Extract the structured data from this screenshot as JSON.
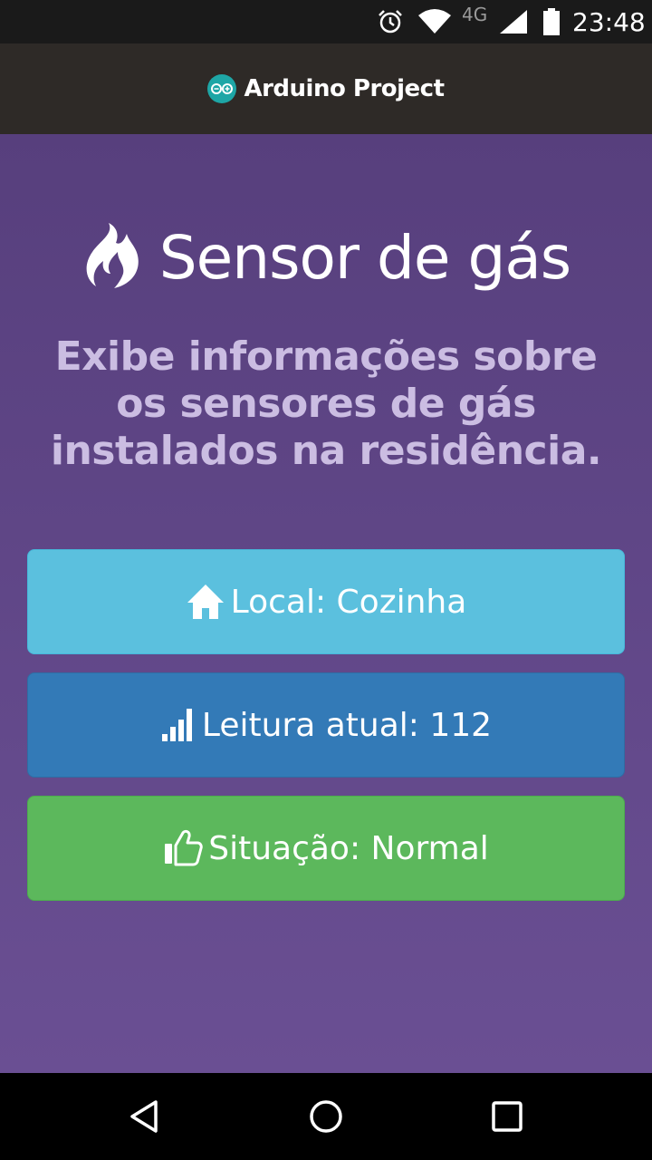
{
  "status_bar": {
    "network": "4G",
    "time": "23:48",
    "icons": [
      "alarm-icon",
      "wifi-icon",
      "signal-icon",
      "battery-icon"
    ]
  },
  "app_bar": {
    "title": "Arduino Project",
    "logo_icon": "arduino-logo-icon"
  },
  "page": {
    "title": "Sensor de gás",
    "title_icon": "fire-icon",
    "subtitle": "Exibe informações sobre os sensores de gás instalados na residência."
  },
  "cards": {
    "local": {
      "label": "Local: Cozinha",
      "icon": "home-icon",
      "color": "#5bc0de"
    },
    "leitura": {
      "label": "Leitura atual: 112",
      "icon": "signal-bars-icon",
      "color": "#337ab7"
    },
    "situacao": {
      "label": "Situação: Normal",
      "icon": "thumbs-up-icon",
      "color": "#5cb85c"
    }
  },
  "nav_bar": {
    "icons": [
      "back-icon",
      "home-circle-icon",
      "recents-icon"
    ]
  },
  "colors": {
    "app_bar_bg": "#2e2a27",
    "main_bg_top": "#573f7d",
    "main_bg_bottom": "#6a4f93",
    "subtitle_text": "#cbbde2"
  }
}
